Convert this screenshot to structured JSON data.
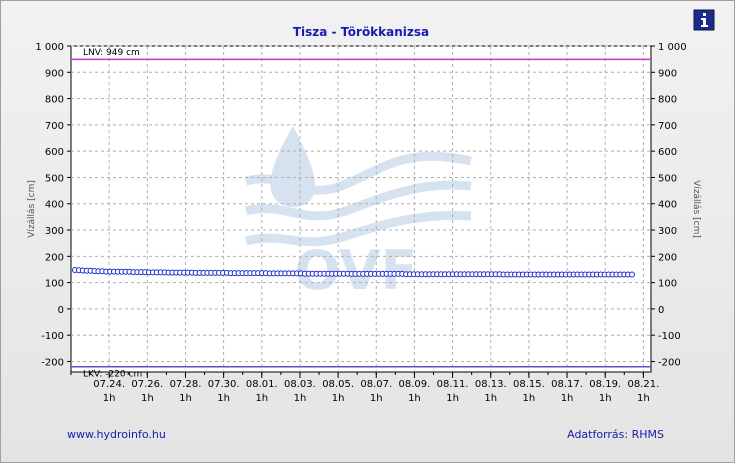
{
  "chart_data": {
    "type": "line",
    "title": "Tisza - Törökkanizsa",
    "ylabel_left": "Vízállás [cm]",
    "ylabel_right": "Vízállás [cm]",
    "ylim": [
      -240,
      1000
    ],
    "yticks": [
      1000,
      900,
      800,
      700,
      600,
      500,
      400,
      300,
      200,
      100,
      0,
      -100,
      -200
    ],
    "ytick_labels": [
      "1 000",
      "900",
      "800",
      "700",
      "600",
      "500",
      "400",
      "300",
      "200",
      "100",
      "0",
      "-100",
      "-200"
    ],
    "x_start_day": 22,
    "x_end_day": 52.4,
    "xtick_dates": [
      "07.24.",
      "07.26.",
      "07.28.",
      "07.30.",
      "08.01.",
      "08.03.",
      "08.05.",
      "08.07.",
      "08.09.",
      "08.11.",
      "08.13.",
      "08.15.",
      "08.17.",
      "08.19.",
      "08.21."
    ],
    "xtick_times": [
      "1h",
      "1h",
      "1h",
      "1h",
      "1h",
      "1h",
      "1h",
      "1h",
      "1h",
      "1h",
      "1h",
      "1h",
      "1h",
      "1h",
      "1h"
    ],
    "grid": true,
    "reference_lines": [
      {
        "label": "LNV: 949 cm",
        "value": 949,
        "color": "#cc33cc"
      },
      {
        "label": "LKV: -220 cm",
        "value": -220,
        "color": "#5555cc"
      }
    ],
    "series": [
      {
        "color": "#1a2bd0",
        "values": [
          148,
          147,
          146,
          145,
          145,
          144,
          143,
          143,
          142,
          142,
          142,
          141,
          141,
          141,
          141,
          140,
          140,
          140,
          140,
          139,
          139,
          139,
          139,
          139,
          138,
          138,
          138,
          138,
          138,
          138,
          138,
          137,
          137,
          137,
          137,
          137,
          137,
          137,
          137,
          137,
          136,
          136,
          136,
          136,
          136,
          136,
          136,
          136,
          136,
          136,
          135,
          135,
          135,
          135,
          135,
          135,
          135,
          135,
          135,
          134,
          134,
          134,
          134,
          134,
          134,
          134,
          134,
          134,
          134,
          134,
          134,
          133,
          133,
          133,
          133,
          133,
          133,
          133,
          133,
          133,
          133,
          133,
          133,
          133,
          133,
          132,
          132,
          132,
          132,
          132,
          132,
          132,
          132,
          132,
          132,
          132,
          132,
          132,
          132,
          132,
          132,
          132,
          132,
          132,
          132,
          132,
          132,
          132,
          132,
          132,
          131,
          131,
          131,
          131,
          131,
          131,
          131,
          131,
          131,
          131,
          131,
          131,
          131,
          131,
          131,
          131,
          131,
          131,
          131,
          131,
          131,
          131,
          131,
          131,
          131,
          131,
          131,
          131,
          131,
          131,
          131,
          131,
          131,
          131
        ]
      }
    ]
  },
  "footer": {
    "website": "www.hydroinfo.hu",
    "source": "Adatforrás: RHMS"
  },
  "watermark": "OVF",
  "info_icon": "info-icon"
}
